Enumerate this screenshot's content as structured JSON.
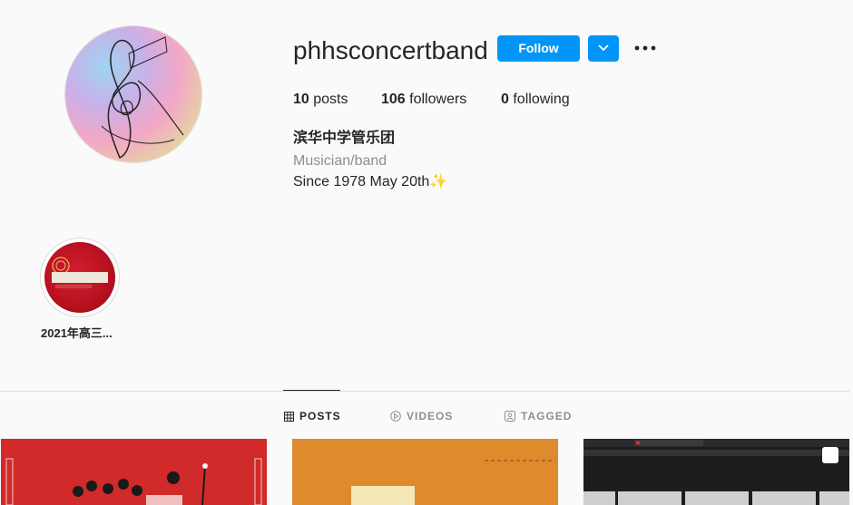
{
  "profile": {
    "username": "phhsconcertband",
    "follow_label": "Follow",
    "stats": {
      "posts_count": "10",
      "posts_label": "posts",
      "followers_count": "106",
      "followers_label": "followers",
      "following_count": "0",
      "following_label": "following"
    },
    "bio": {
      "name": "滨华中学管乐团",
      "category": "Musician/band",
      "text": "Since 1978 May 20th✨"
    }
  },
  "highlights": [
    {
      "label": "2021年高三..."
    }
  ],
  "tabs": [
    {
      "label": "POSTS",
      "icon": "grid-icon",
      "active": true
    },
    {
      "label": "VIDEOS",
      "icon": "play-icon",
      "active": false
    },
    {
      "label": "TAGGED",
      "icon": "tagged-icon",
      "active": false
    }
  ],
  "posts": [
    {
      "theme": "red-illustration"
    },
    {
      "theme": "orange-poster"
    },
    {
      "theme": "dark-screenshot"
    }
  ],
  "colors": {
    "primary_button": "#0095f6",
    "text": "#262626",
    "muted_text": "#8e8e8e",
    "background": "#fafafa",
    "divider": "#dbdbdb"
  }
}
